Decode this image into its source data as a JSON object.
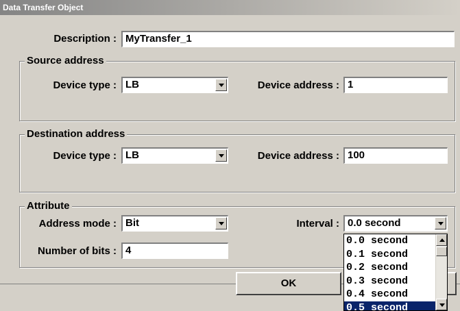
{
  "window": {
    "title": "Data Transfer Object"
  },
  "description": {
    "label": "Description :",
    "value": "MyTransfer_1"
  },
  "source": {
    "group_title": "Source address",
    "device_type_label": "Device type :",
    "device_type_value": "LB",
    "device_address_label": "Device address :",
    "device_address_value": "1"
  },
  "destination": {
    "group_title": "Destination address",
    "device_type_label": "Device type :",
    "device_type_value": "LB",
    "device_address_label": "Device  address :",
    "device_address_value": "100"
  },
  "attribute": {
    "group_title": "Attribute",
    "address_mode_label": "Address mode :",
    "address_mode_value": "Bit",
    "number_of_bits_label": "Number of bits :",
    "number_of_bits_value": "4",
    "interval_label": "Interval :",
    "interval_value": "0.0 second",
    "interval_options": [
      "0.0 second",
      "0.1 second",
      "0.2 second",
      "0.3 second",
      "0.4 second",
      "0.5 second"
    ],
    "interval_highlighted": "0.5 second"
  },
  "buttons": {
    "ok_label": "OK"
  },
  "colors": {
    "selection": "#0a246a",
    "dialog_bg": "#d4d0c8"
  }
}
